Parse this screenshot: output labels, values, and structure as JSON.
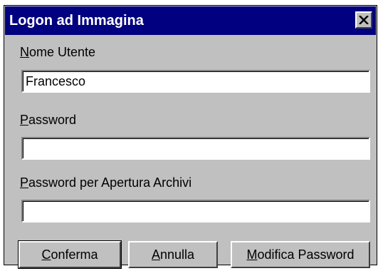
{
  "window": {
    "title": "Logon ad Immagina",
    "close_icon": "close-x-icon"
  },
  "fields": {
    "username": {
      "label_mnemonic": "N",
      "label_rest": "ome Utente",
      "value": "Francesco"
    },
    "password": {
      "label_mnemonic": "P",
      "label_rest": "assword",
      "value": ""
    },
    "archive_password": {
      "label_mnemonic": "P",
      "label_rest": "assword per Apertura Archivi",
      "value": ""
    }
  },
  "buttons": {
    "confirm": {
      "mnemonic": "C",
      "rest": "onferma"
    },
    "cancel": {
      "mnemonic": "A",
      "rest": "nnulla"
    },
    "change_password": {
      "mnemonic": "M",
      "rest": "odifica Password"
    }
  },
  "colors": {
    "titlebar": "#000080",
    "face": "#c0c0c0"
  }
}
